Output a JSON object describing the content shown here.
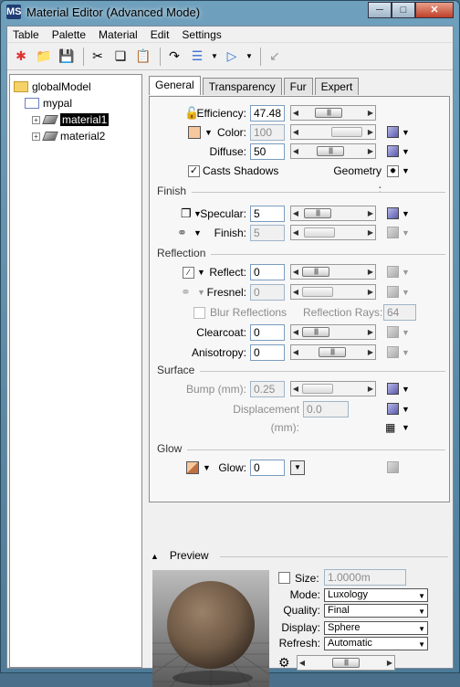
{
  "window": {
    "title": "Material Editor (Advanced Mode)",
    "app_icon": "MS"
  },
  "menu": [
    "Table",
    "Palette",
    "Material",
    "Edit",
    "Settings"
  ],
  "tree": {
    "root": "globalModel",
    "palette": "mypal",
    "materials": [
      "material1",
      "material2"
    ]
  },
  "tabs": [
    "General",
    "Transparency",
    "Fur",
    "Expert"
  ],
  "general": {
    "efficiency": {
      "label": "Efficiency:",
      "value": "47.48"
    },
    "color": {
      "label": "Color:",
      "value": "100",
      "swatch": "#f5c8a0"
    },
    "diffuse": {
      "label": "Diffuse:",
      "value": "50"
    },
    "casts_shadows": {
      "label": "Casts Shadows",
      "checked": true
    },
    "geometry_label": "Geometry :",
    "finish_header": "Finish",
    "specular": {
      "label": "Specular:",
      "value": "5"
    },
    "finish": {
      "label": "Finish:",
      "value": "5"
    },
    "reflection_header": "Reflection",
    "reflect": {
      "label": "Reflect:",
      "value": "0"
    },
    "fresnel": {
      "label": "Fresnel:",
      "value": "0"
    },
    "blur_reflections": {
      "label": "Blur Reflections",
      "checked": false
    },
    "reflection_rays": {
      "label": "Reflection Rays:",
      "value": "64"
    },
    "clearcoat": {
      "label": "Clearcoat:",
      "value": "0"
    },
    "anisotropy": {
      "label": "Anisotropy:",
      "value": "0"
    },
    "surface_header": "Surface",
    "bump": {
      "label": "Bump (mm):",
      "value": "0.25"
    },
    "displacement": {
      "label": "Displacement (mm):",
      "value": "0.0"
    },
    "glow_header": "Glow",
    "glow": {
      "label": "Glow:",
      "value": "0"
    }
  },
  "preview": {
    "header": "Preview",
    "size": {
      "label": "Size:",
      "value": "1.0000m",
      "checked": false
    },
    "mode": {
      "label": "Mode:",
      "value": "Luxology"
    },
    "quality": {
      "label": "Quality:",
      "value": "Final"
    },
    "display": {
      "label": "Display:",
      "value": "Sphere"
    },
    "refresh": {
      "label": "Refresh:",
      "value": "Automatic"
    }
  },
  "colors": {
    "accent": "#6fa0bd",
    "sphere": "#7a6450"
  }
}
